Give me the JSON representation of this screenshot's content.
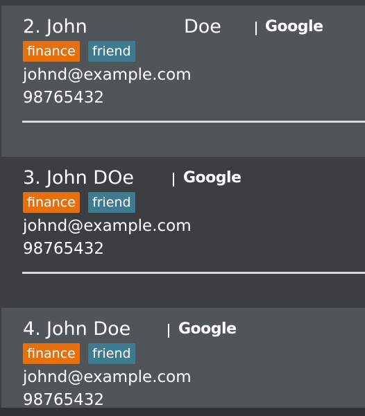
{
  "persons": [
    {
      "index": "2.",
      "first_name": "John",
      "last_name": "Doe",
      "organization": "Google",
      "tags": [
        "finance",
        "friend"
      ],
      "email": "johnd@example.com",
      "phone": "98765432"
    },
    {
      "index": "3.",
      "first_name": "John DOe",
      "last_name": "",
      "organization": "Google",
      "tags": [
        "finance",
        "friend"
      ],
      "email": "johnd@example.com",
      "phone": "98765432"
    },
    {
      "index": "4.",
      "first_name": "John Doe",
      "last_name": "",
      "organization": "Google",
      "tags": [
        "finance",
        "friend"
      ],
      "email": "johnd@example.com",
      "phone": "98765432"
    }
  ],
  "colors": {
    "card_light": "#50555a",
    "card_dark": "#3c3f41",
    "tag_finance": "#e6700e",
    "tag_friend": "#3e7b91"
  }
}
